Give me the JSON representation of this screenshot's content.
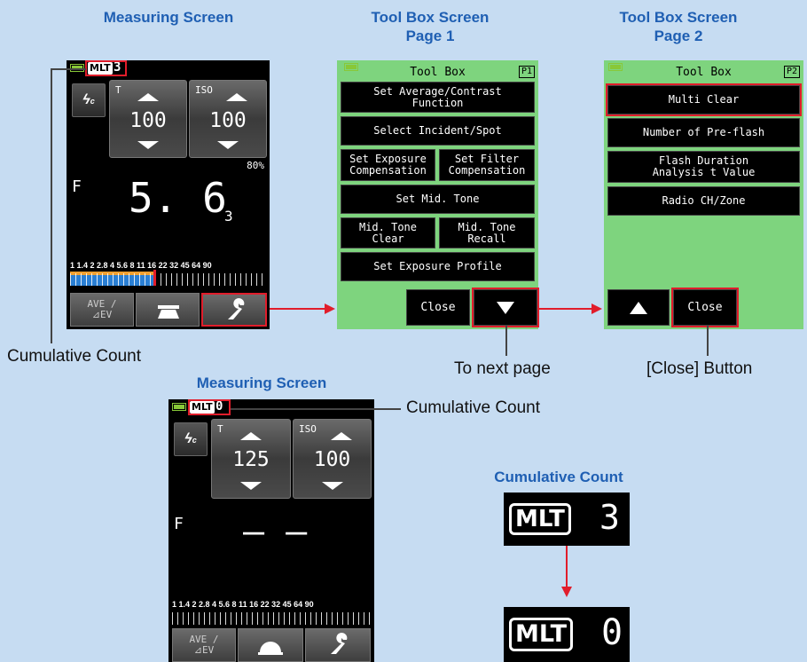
{
  "headings": {
    "measuring_top": "Measuring Screen",
    "toolbox_p1": "Tool Box Screen\nPage 1",
    "toolbox_p2": "Tool Box Screen\nPage 2",
    "measuring_bottom": "Measuring Screen",
    "cumulative_count": "Cumulative Count"
  },
  "captions": {
    "cumulative_left": "Cumulative Count",
    "to_next_page": "To next page",
    "close_button": "[Close] Button",
    "cumulative_right": "Cumulative Count"
  },
  "meter1": {
    "mlt_label": "MLT",
    "mlt_count": "3",
    "t_label": "T",
    "t_value": "100",
    "iso_label": "ISO",
    "iso_value": "100",
    "percent": "80%",
    "f_label": "F",
    "f_value": "5. 6",
    "f_sub": "3",
    "scale": "1  1.4  2  2.8  4  5.6  8  11  16  22  32  45  64  90",
    "ave_label": "AVE /\n⊿EV"
  },
  "meter2": {
    "mlt_label": "MLT",
    "mlt_count": "0",
    "t_label": "T",
    "t_value": "125",
    "iso_label": "ISO",
    "iso_value": "100",
    "f_label": "F",
    "f_value": "– –",
    "scale": "1  1.4  2  2.8  4  5.6  8  11  16  22  32  45  64  90",
    "ave_label": "AVE /\n⊿EV"
  },
  "toolbox1": {
    "title": "Tool Box",
    "page": "P1",
    "buttons": [
      "Set Average/Contrast\nFunction",
      "Select Incident/Spot",
      "Set Exposure\nCompensation",
      "Set Filter\nCompensation",
      "Set Mid. Tone",
      "Mid. Tone\nClear",
      "Mid. Tone\nRecall",
      "Set Exposure Profile"
    ],
    "close": "Close"
  },
  "toolbox2": {
    "title": "Tool Box",
    "page": "P2",
    "buttons": [
      "Multi Clear",
      "Number of Pre-flash",
      "Flash Duration\nAnalysis t Value",
      "Radio CH/Zone"
    ],
    "close": "Close"
  },
  "zoom": {
    "before_label": "MLT",
    "before_count": "3",
    "after_label": "MLT",
    "after_count": "0"
  },
  "colors": {
    "accent_red": "#e11d2b",
    "heading_blue": "#1f5fb3",
    "toolbox_green": "#7ed47e"
  }
}
